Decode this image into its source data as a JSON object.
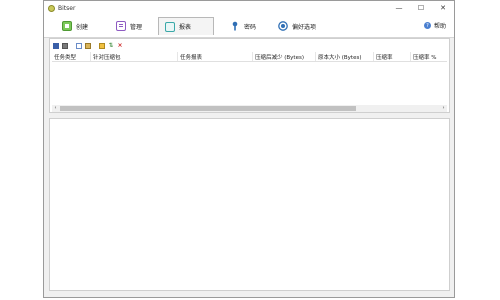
{
  "window": {
    "title": "Bitser"
  },
  "controls": {
    "minimize": "—",
    "maximize": "☐",
    "close": "✕"
  },
  "tabs": [
    {
      "label": "创建",
      "icon": "create-icon",
      "color": "#6cbf4a",
      "active": false
    },
    {
      "label": "管理",
      "icon": "manage-icon",
      "color": "#8e5bc2",
      "active": false
    },
    {
      "label": "报表",
      "icon": "report-icon",
      "color": "#3aa8a8",
      "active": true
    },
    {
      "label": "密码",
      "icon": "key-icon",
      "color": "#2f6fb5",
      "active": false
    },
    {
      "label": "偏好选项",
      "icon": "preferences-icon",
      "color": "#2f6fb5",
      "active": false
    }
  ],
  "help": {
    "label": "帮助"
  },
  "toolbar": {
    "icons": [
      "save-icon",
      "print-icon",
      "copy-icon",
      "clipboard-icon",
      "folder-icon",
      "refresh-icon",
      "delete-icon"
    ]
  },
  "table": {
    "columns": [
      "任务类型",
      "针对压缩包",
      "任务报表",
      "压缩后减少 (Bytes)",
      "原本大小 (Bytes)",
      "压缩率",
      "压缩率 %"
    ],
    "rows": []
  },
  "scrollbar": {
    "left": "‹",
    "right": "›"
  }
}
